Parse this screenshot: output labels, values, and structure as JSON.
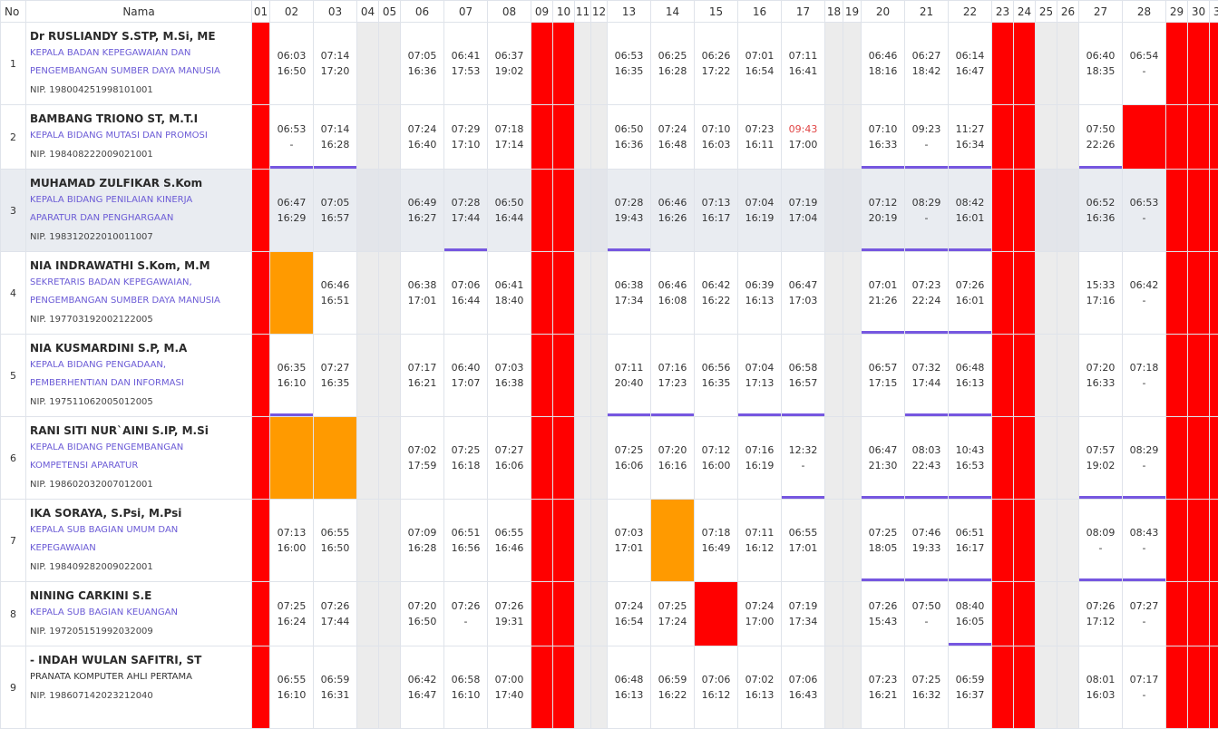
{
  "headers": {
    "no": "No",
    "nama": "Nama",
    "days": [
      "01",
      "02",
      "03",
      "04",
      "05",
      "06",
      "07",
      "08",
      "09",
      "10",
      "11",
      "12",
      "13",
      "14",
      "15",
      "16",
      "17",
      "18",
      "19",
      "20",
      "21",
      "22",
      "23",
      "24",
      "25",
      "26",
      "27",
      "28",
      "29",
      "30",
      "31"
    ]
  },
  "legend_colors": {
    "weekend": "#ff0000",
    "holiday": "#ececec",
    "leave": "#ff9a00",
    "absent": "#ff0000",
    "marker": "#7657e0",
    "role_text": "#6b5bd6",
    "late_text": "#e04444"
  },
  "rows": [
    {
      "no": "1",
      "name": "Dr RUSLIANDY S.STP, M.Si, ME",
      "role_lines": [
        "KEPALA BADAN KEPEGAWAIAN DAN",
        "PENGEMBANGAN SUMBER DAYA MANUSIA"
      ],
      "nip": "NIP. 198004251998101001",
      "cells": [
        {
          "s": "w"
        },
        {
          "in": "06:03",
          "out": "16:50"
        },
        {
          "in": "07:14",
          "out": "17:20"
        },
        {
          "s": "h"
        },
        {
          "s": "h"
        },
        {
          "in": "07:05",
          "out": "16:36"
        },
        {
          "in": "06:41",
          "out": "17:53"
        },
        {
          "in": "06:37",
          "out": "19:02"
        },
        {
          "s": "w"
        },
        {
          "s": "w"
        },
        {
          "s": "h"
        },
        {
          "s": "h"
        },
        {
          "in": "06:53",
          "out": "16:35"
        },
        {
          "in": "06:25",
          "out": "16:28"
        },
        {
          "in": "06:26",
          "out": "17:22"
        },
        {
          "in": "07:01",
          "out": "16:54"
        },
        {
          "in": "07:11",
          "out": "16:41"
        },
        {
          "s": "h"
        },
        {
          "s": "h"
        },
        {
          "in": "06:46",
          "out": "18:16"
        },
        {
          "in": "06:27",
          "out": "18:42"
        },
        {
          "in": "06:14",
          "out": "16:47"
        },
        {
          "s": "w"
        },
        {
          "s": "w"
        },
        {
          "s": "h"
        },
        {
          "s": "h"
        },
        {
          "in": "06:40",
          "out": "18:35"
        },
        {
          "in": "06:54",
          "out": "-"
        },
        {
          "s": "w"
        },
        {
          "s": "w"
        },
        {
          "s": "w"
        }
      ]
    },
    {
      "no": "2",
      "name": "BAMBANG TRIONO ST, M.T.I",
      "role_lines": [
        "KEPALA BIDANG MUTASI DAN PROMOSI"
      ],
      "nip": "NIP. 198408222009021001",
      "cells": [
        {
          "s": "w"
        },
        {
          "in": "06:53",
          "out": "-",
          "m": 1
        },
        {
          "in": "07:14",
          "out": "16:28",
          "m": 1
        },
        {
          "s": "h"
        },
        {
          "s": "h"
        },
        {
          "in": "07:24",
          "out": "16:40"
        },
        {
          "in": "07:29",
          "out": "17:10"
        },
        {
          "in": "07:18",
          "out": "17:14"
        },
        {
          "s": "w"
        },
        {
          "s": "w"
        },
        {
          "s": "h"
        },
        {
          "s": "h"
        },
        {
          "in": "06:50",
          "out": "16:36"
        },
        {
          "in": "07:24",
          "out": "16:48"
        },
        {
          "in": "07:10",
          "out": "16:03"
        },
        {
          "in": "07:23",
          "out": "16:11"
        },
        {
          "in": "09:43",
          "out": "17:00",
          "late": 1
        },
        {
          "s": "h"
        },
        {
          "s": "h"
        },
        {
          "in": "07:10",
          "out": "16:33",
          "m": 1
        },
        {
          "in": "09:23",
          "out": "-",
          "m": 1
        },
        {
          "in": "11:27",
          "out": "16:34",
          "m": 1
        },
        {
          "s": "w"
        },
        {
          "s": "w"
        },
        {
          "s": "h"
        },
        {
          "s": "h"
        },
        {
          "in": "07:50",
          "out": "22:26",
          "m": 1
        },
        {
          "s": "r"
        },
        {
          "s": "w"
        },
        {
          "s": "w"
        },
        {
          "s": "w"
        }
      ]
    },
    {
      "no": "3",
      "name": "MUHAMAD ZULFIKAR S.Kom",
      "hl": 1,
      "role_lines": [
        "KEPALA BIDANG PENILAIAN KINERJA",
        "APARATUR DAN PENGHARGAAN"
      ],
      "nip": "NIP. 198312022010011007",
      "cells": [
        {
          "s": "w"
        },
        {
          "in": "06:47",
          "out": "16:29"
        },
        {
          "in": "07:05",
          "out": "16:57"
        },
        {
          "s": "h"
        },
        {
          "s": "h"
        },
        {
          "in": "06:49",
          "out": "16:27"
        },
        {
          "in": "07:28",
          "out": "17:44",
          "m": 1
        },
        {
          "in": "06:50",
          "out": "16:44"
        },
        {
          "s": "w"
        },
        {
          "s": "w"
        },
        {
          "s": "h"
        },
        {
          "s": "h"
        },
        {
          "in": "07:28",
          "out": "19:43",
          "m": 1
        },
        {
          "in": "06:46",
          "out": "16:26"
        },
        {
          "in": "07:13",
          "out": "16:17"
        },
        {
          "in": "07:04",
          "out": "16:19"
        },
        {
          "in": "07:19",
          "out": "17:04"
        },
        {
          "s": "h"
        },
        {
          "s": "h"
        },
        {
          "in": "07:12",
          "out": "20:19",
          "m": 1
        },
        {
          "in": "08:29",
          "out": "-",
          "m": 1
        },
        {
          "in": "08:42",
          "out": "16:01",
          "m": 1
        },
        {
          "s": "w"
        },
        {
          "s": "w"
        },
        {
          "s": "h"
        },
        {
          "s": "h"
        },
        {
          "in": "06:52",
          "out": "16:36"
        },
        {
          "in": "06:53",
          "out": "-"
        },
        {
          "s": "w"
        },
        {
          "s": "w"
        },
        {
          "s": "w"
        }
      ]
    },
    {
      "no": "4",
      "name": "NIA INDRAWATHI S.Kom, M.M",
      "role_lines": [
        "SEKRETARIS BADAN KEPEGAWAIAN,",
        "PENGEMBANGAN SUMBER DAYA MANUSIA"
      ],
      "nip": "NIP. 197703192002122005",
      "cells": [
        {
          "s": "w"
        },
        {
          "s": "o"
        },
        {
          "in": "06:46",
          "out": "16:51"
        },
        {
          "s": "h"
        },
        {
          "s": "h"
        },
        {
          "in": "06:38",
          "out": "17:01"
        },
        {
          "in": "07:06",
          "out": "16:44"
        },
        {
          "in": "06:41",
          "out": "18:40"
        },
        {
          "s": "w"
        },
        {
          "s": "w"
        },
        {
          "s": "h"
        },
        {
          "s": "h"
        },
        {
          "in": "06:38",
          "out": "17:34"
        },
        {
          "in": "06:46",
          "out": "16:08"
        },
        {
          "in": "06:42",
          "out": "16:22"
        },
        {
          "in": "06:39",
          "out": "16:13"
        },
        {
          "in": "06:47",
          "out": "17:03"
        },
        {
          "s": "h"
        },
        {
          "s": "h"
        },
        {
          "in": "07:01",
          "out": "21:26",
          "m": 1
        },
        {
          "in": "07:23",
          "out": "22:24",
          "m": 1
        },
        {
          "in": "07:26",
          "out": "16:01",
          "m": 1
        },
        {
          "s": "w"
        },
        {
          "s": "w"
        },
        {
          "s": "h"
        },
        {
          "s": "h"
        },
        {
          "in": "15:33",
          "out": "17:16"
        },
        {
          "in": "06:42",
          "out": "-"
        },
        {
          "s": "w"
        },
        {
          "s": "w"
        },
        {
          "s": "w"
        }
      ]
    },
    {
      "no": "5",
      "name": "NIA KUSMARDINI S.P, M.A",
      "role_lines": [
        "KEPALA BIDANG PENGADAAN,",
        "PEMBERHENTIAN DAN INFORMASI"
      ],
      "nip": "NIP. 197511062005012005",
      "cells": [
        {
          "s": "w"
        },
        {
          "in": "06:35",
          "out": "16:10",
          "m": 1
        },
        {
          "in": "07:27",
          "out": "16:35"
        },
        {
          "s": "h"
        },
        {
          "s": "h"
        },
        {
          "in": "07:17",
          "out": "16:21"
        },
        {
          "in": "06:40",
          "out": "17:07"
        },
        {
          "in": "07:03",
          "out": "16:38"
        },
        {
          "s": "w"
        },
        {
          "s": "w"
        },
        {
          "s": "h"
        },
        {
          "s": "h"
        },
        {
          "in": "07:11",
          "out": "20:40",
          "m": 1
        },
        {
          "in": "07:16",
          "out": "17:23",
          "m": 1
        },
        {
          "in": "06:56",
          "out": "16:35"
        },
        {
          "in": "07:04",
          "out": "17:13",
          "m": 1
        },
        {
          "in": "06:58",
          "out": "16:57",
          "m": 1
        },
        {
          "s": "h"
        },
        {
          "s": "h"
        },
        {
          "in": "06:57",
          "out": "17:15"
        },
        {
          "in": "07:32",
          "out": "17:44",
          "m": 1
        },
        {
          "in": "06:48",
          "out": "16:13",
          "m": 1
        },
        {
          "s": "w"
        },
        {
          "s": "w"
        },
        {
          "s": "h"
        },
        {
          "s": "h"
        },
        {
          "in": "07:20",
          "out": "16:33"
        },
        {
          "in": "07:18",
          "out": "-"
        },
        {
          "s": "w"
        },
        {
          "s": "w"
        },
        {
          "s": "w"
        }
      ]
    },
    {
      "no": "6",
      "name": "RANI SITI NUR`AINI S.IP, M.Si",
      "role_lines": [
        "KEPALA BIDANG PENGEMBANGAN",
        "KOMPETENSI APARATUR"
      ],
      "nip": "NIP. 198602032007012001",
      "cells": [
        {
          "s": "w"
        },
        {
          "s": "o"
        },
        {
          "s": "o"
        },
        {
          "s": "h"
        },
        {
          "s": "h"
        },
        {
          "in": "07:02",
          "out": "17:59"
        },
        {
          "in": "07:25",
          "out": "16:18"
        },
        {
          "in": "07:27",
          "out": "16:06"
        },
        {
          "s": "w"
        },
        {
          "s": "w"
        },
        {
          "s": "h"
        },
        {
          "s": "h"
        },
        {
          "in": "07:25",
          "out": "16:06"
        },
        {
          "in": "07:20",
          "out": "16:16"
        },
        {
          "in": "07:12",
          "out": "16:00"
        },
        {
          "in": "07:16",
          "out": "16:19"
        },
        {
          "in": "12:32",
          "out": "-",
          "m": 1
        },
        {
          "s": "h"
        },
        {
          "s": "h"
        },
        {
          "in": "06:47",
          "out": "21:30",
          "m": 1
        },
        {
          "in": "08:03",
          "out": "22:43",
          "m": 1
        },
        {
          "in": "10:43",
          "out": "16:53",
          "m": 1
        },
        {
          "s": "w"
        },
        {
          "s": "w"
        },
        {
          "s": "h"
        },
        {
          "s": "h"
        },
        {
          "in": "07:57",
          "out": "19:02",
          "m": 1
        },
        {
          "in": "08:29",
          "out": "-",
          "m": 1
        },
        {
          "s": "w"
        },
        {
          "s": "w"
        },
        {
          "s": "w"
        }
      ]
    },
    {
      "no": "7",
      "name": "IKA SORAYA, S.Psi, M.Psi",
      "role_lines": [
        "KEPALA SUB BAGIAN UMUM DAN",
        "KEPEGAWAIAN"
      ],
      "nip": "NIP. 198409282009022001",
      "cells": [
        {
          "s": "w"
        },
        {
          "in": "07:13",
          "out": "16:00"
        },
        {
          "in": "06:55",
          "out": "16:50"
        },
        {
          "s": "h"
        },
        {
          "s": "h"
        },
        {
          "in": "07:09",
          "out": "16:28"
        },
        {
          "in": "06:51",
          "out": "16:56"
        },
        {
          "in": "06:55",
          "out": "16:46"
        },
        {
          "s": "w"
        },
        {
          "s": "w"
        },
        {
          "s": "h"
        },
        {
          "s": "h"
        },
        {
          "in": "07:03",
          "out": "17:01"
        },
        {
          "s": "o"
        },
        {
          "in": "07:18",
          "out": "16:49"
        },
        {
          "in": "07:11",
          "out": "16:12"
        },
        {
          "in": "06:55",
          "out": "17:01"
        },
        {
          "s": "h"
        },
        {
          "s": "h"
        },
        {
          "in": "07:25",
          "out": "18:05",
          "m": 1
        },
        {
          "in": "07:46",
          "out": "19:33",
          "m": 1
        },
        {
          "in": "06:51",
          "out": "16:17",
          "m": 1
        },
        {
          "s": "w"
        },
        {
          "s": "w"
        },
        {
          "s": "h"
        },
        {
          "s": "h"
        },
        {
          "in": "08:09",
          "out": "-",
          "m": 1
        },
        {
          "in": "08:43",
          "out": "-",
          "m": 1
        },
        {
          "s": "w"
        },
        {
          "s": "w"
        },
        {
          "s": "w"
        }
      ]
    },
    {
      "no": "8",
      "name": "NINING CARKINI S.E",
      "role_lines": [
        "KEPALA SUB BAGIAN KEUANGAN"
      ],
      "nip": "NIP. 197205151992032009",
      "cells": [
        {
          "s": "w"
        },
        {
          "in": "07:25",
          "out": "16:24"
        },
        {
          "in": "07:26",
          "out": "17:44"
        },
        {
          "s": "h"
        },
        {
          "s": "h"
        },
        {
          "in": "07:20",
          "out": "16:50"
        },
        {
          "in": "07:26",
          "out": "-"
        },
        {
          "in": "07:26",
          "out": "19:31"
        },
        {
          "s": "w"
        },
        {
          "s": "w"
        },
        {
          "s": "h"
        },
        {
          "s": "h"
        },
        {
          "in": "07:24",
          "out": "16:54"
        },
        {
          "in": "07:25",
          "out": "17:24"
        },
        {
          "s": "r"
        },
        {
          "in": "07:24",
          "out": "17:00"
        },
        {
          "in": "07:19",
          "out": "17:34"
        },
        {
          "s": "h"
        },
        {
          "s": "h"
        },
        {
          "in": "07:26",
          "out": "15:43"
        },
        {
          "in": "07:50",
          "out": "-"
        },
        {
          "in": "08:40",
          "out": "16:05",
          "m": 1
        },
        {
          "s": "w"
        },
        {
          "s": "w"
        },
        {
          "s": "h"
        },
        {
          "s": "h"
        },
        {
          "in": "07:26",
          "out": "17:12"
        },
        {
          "in": "07:27",
          "out": "-"
        },
        {
          "s": "w"
        },
        {
          "s": "w"
        },
        {
          "s": "w"
        }
      ]
    },
    {
      "no": "9",
      "name": "- INDAH WULAN SAFITRI, ST",
      "plain_role": 1,
      "role_lines": [
        "PRANATA KOMPUTER AHLI PERTAMA"
      ],
      "nip": "NIP. 198607142023212040",
      "cells": [
        {
          "s": "w"
        },
        {
          "in": "06:55",
          "out": "16:10"
        },
        {
          "in": "06:59",
          "out": "16:31"
        },
        {
          "s": "h"
        },
        {
          "s": "h"
        },
        {
          "in": "06:42",
          "out": "16:47"
        },
        {
          "in": "06:58",
          "out": "16:10"
        },
        {
          "in": "07:00",
          "out": "17:40"
        },
        {
          "s": "w"
        },
        {
          "s": "w"
        },
        {
          "s": "h"
        },
        {
          "s": "h"
        },
        {
          "in": "06:48",
          "out": "16:13"
        },
        {
          "in": "06:59",
          "out": "16:22"
        },
        {
          "in": "07:06",
          "out": "16:12"
        },
        {
          "in": "07:02",
          "out": "16:13"
        },
        {
          "in": "07:06",
          "out": "16:43"
        },
        {
          "s": "h"
        },
        {
          "s": "h"
        },
        {
          "in": "07:23",
          "out": "16:21"
        },
        {
          "in": "07:25",
          "out": "16:32"
        },
        {
          "in": "06:59",
          "out": "16:37"
        },
        {
          "s": "w"
        },
        {
          "s": "w"
        },
        {
          "s": "h"
        },
        {
          "s": "h"
        },
        {
          "in": "08:01",
          "out": "16:03"
        },
        {
          "in": "07:17",
          "out": "-"
        },
        {
          "s": "w"
        },
        {
          "s": "w"
        },
        {
          "s": "w"
        }
      ]
    }
  ]
}
